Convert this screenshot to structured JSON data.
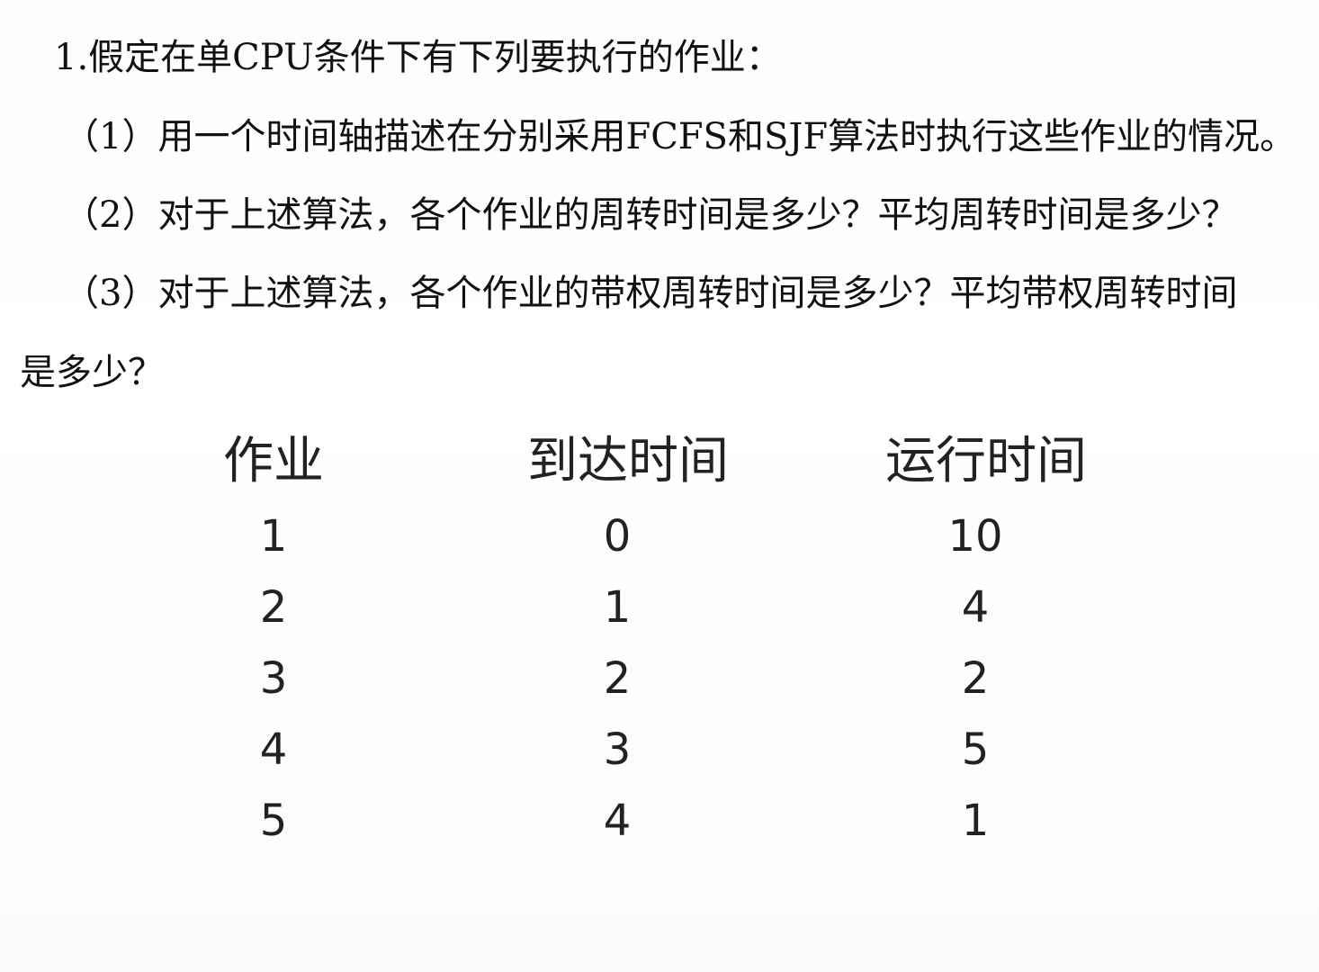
{
  "question": {
    "title": "1.假定在单CPU条件下有下列要执行的作业：",
    "sub1": "（1）用一个时间轴描述在分别采用FCFS和SJF算法时执行这些作业的情况。",
    "sub2": "（2）对于上述算法，各个作业的周转时间是多少？平均周转时间是多少？",
    "sub3": "（3）对于上述算法，各个作业的带权周转时间是多少？平均带权周转时间",
    "sub3_cont": "是多少？"
  },
  "table": {
    "headers": [
      "作业",
      "到达时间",
      "运行时间"
    ],
    "rows": [
      [
        "1",
        "0",
        "10"
      ],
      [
        "2",
        "1",
        "4"
      ],
      [
        "3",
        "2",
        "2"
      ],
      [
        "4",
        "3",
        "5"
      ],
      [
        "5",
        "4",
        "1"
      ]
    ]
  }
}
